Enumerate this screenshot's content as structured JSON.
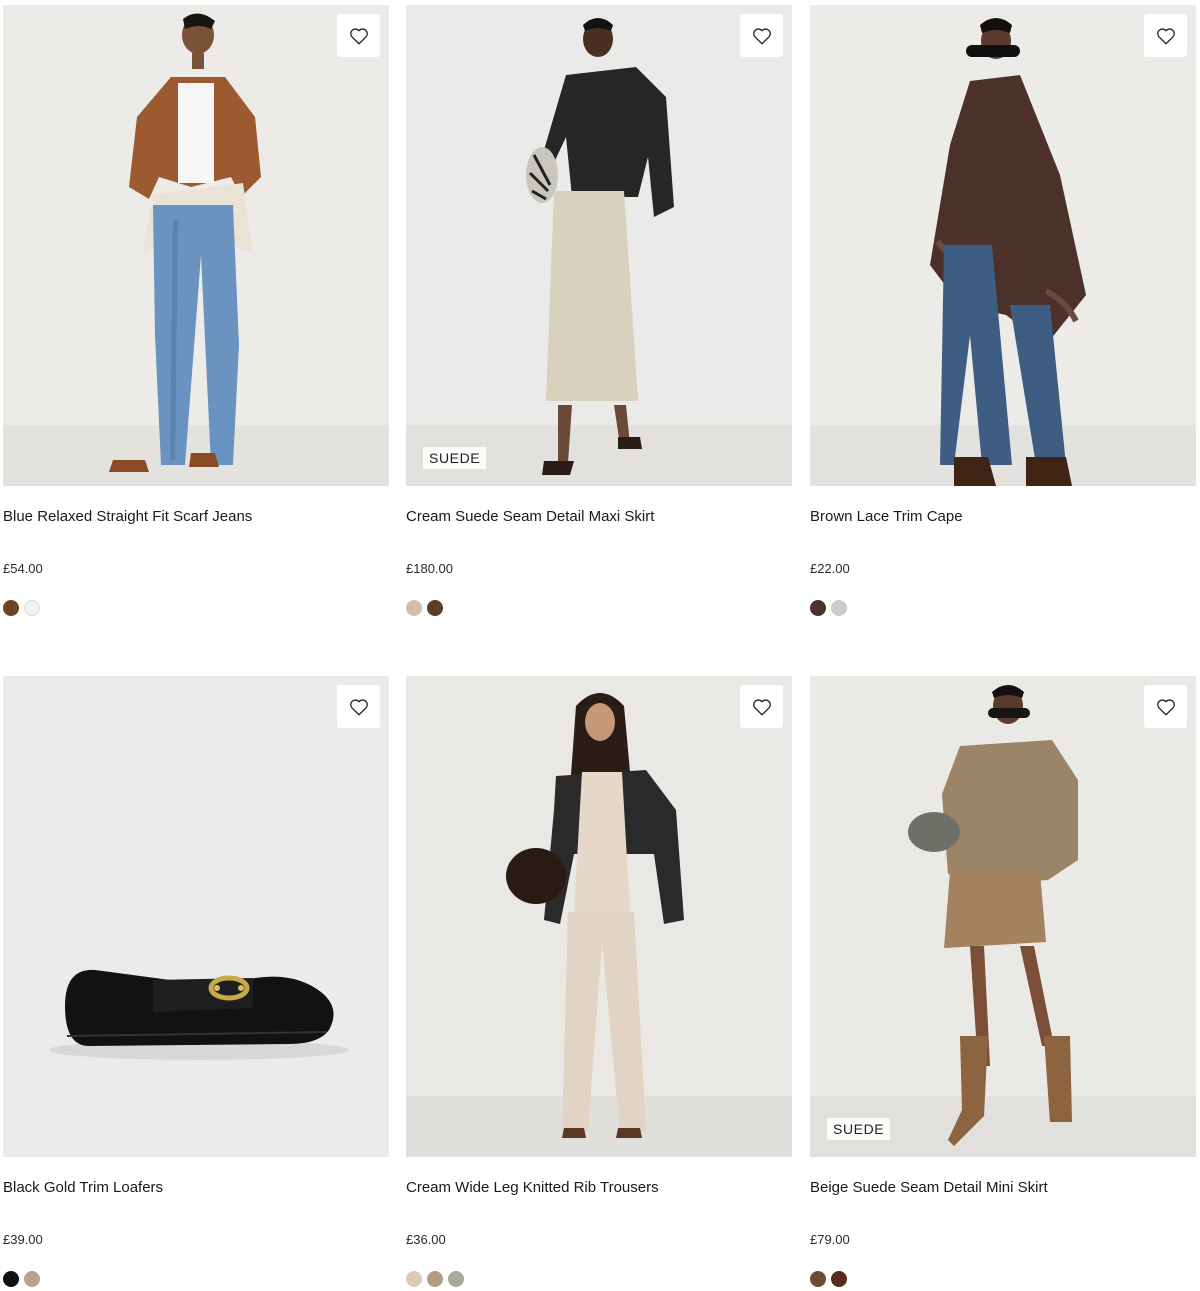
{
  "products": [
    {
      "title": "Blue Relaxed Straight Fit Scarf Jeans",
      "price": "£54.00",
      "badge": "",
      "swatches": [
        "#6b4423",
        "#f2f2f2"
      ]
    },
    {
      "title": "Cream Suede Seam Detail Maxi Skirt",
      "price": "£180.00",
      "badge": "SUEDE",
      "swatches": [
        "#cdbfa8",
        "#5a4126"
      ]
    },
    {
      "title": "Brown Lace Trim Cape",
      "price": "£22.00",
      "badge": "",
      "swatches": [
        "#4a3430",
        "#c9cdcf"
      ]
    },
    {
      "title": "Black Gold Trim Loafers",
      "price": "£39.00",
      "badge": "",
      "swatches": [
        "#111111",
        "#b3a58f"
      ]
    },
    {
      "title": "Cream Wide Leg Knitted Rib Trousers",
      "price": "£36.00",
      "badge": "",
      "swatches": [
        "#d9cbbd",
        "#b39c86",
        "#a3ad97"
      ]
    },
    {
      "title": "Beige Suede Seam Detail Mini Skirt",
      "price": "£79.00",
      "badge": "SUEDE",
      "swatches": [
        "#6b4e31",
        "#5a2a22"
      ]
    }
  ],
  "icons": {
    "wishlist": "heart-outline-icon"
  }
}
